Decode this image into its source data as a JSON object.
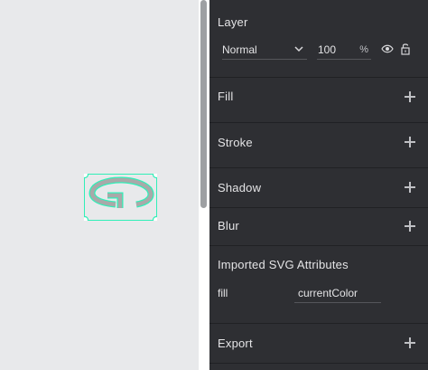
{
  "panel": {
    "layer": {
      "title": "Layer",
      "blend_mode": "Normal",
      "opacity": "100",
      "opacity_unit": "%"
    },
    "sections": {
      "fill": "Fill",
      "stroke": "Stroke",
      "shadow": "Shadow",
      "blur": "Blur",
      "imported_svg": "Imported SVG Attributes",
      "export": "Export"
    },
    "svg_attributes": [
      {
        "key": "fill",
        "value": "currentColor"
      }
    ]
  },
  "canvas": {
    "selected_shape_icon": "rotate-clockwise-icon"
  },
  "colors": {
    "panel_bg": "#2e2f33",
    "canvas_bg": "#e8e9eb",
    "selection": "#31efb8",
    "shape_fill": "#a9a9a9"
  }
}
